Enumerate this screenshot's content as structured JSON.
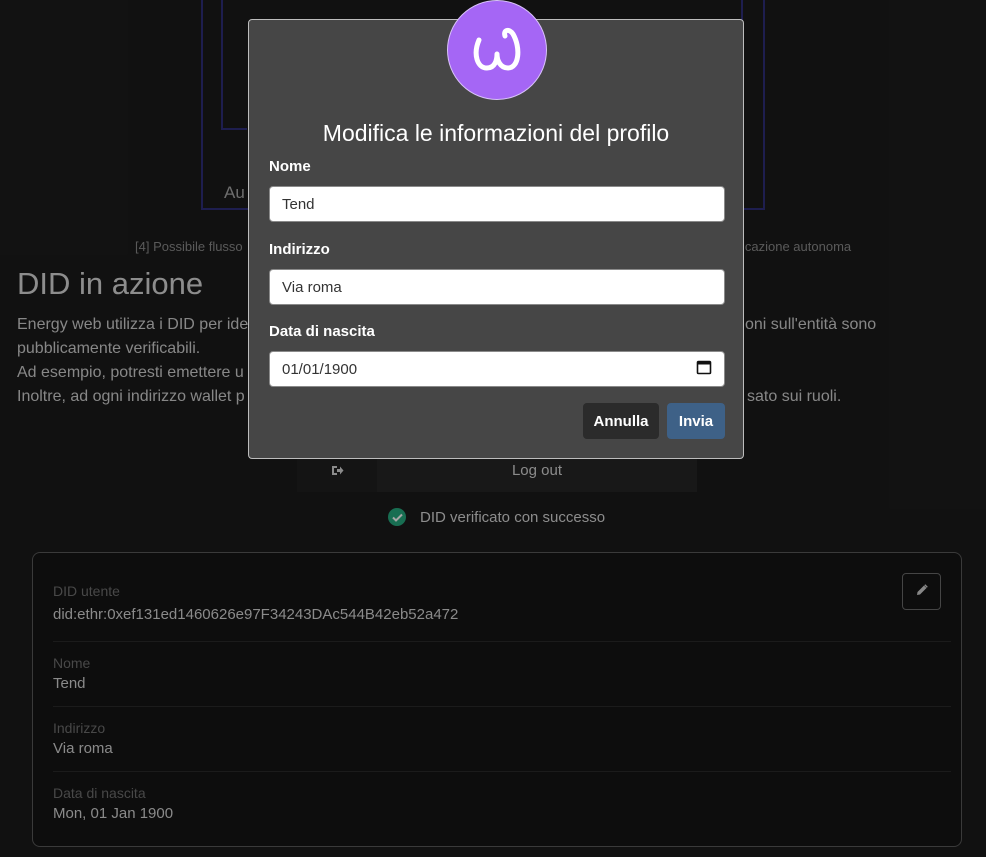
{
  "background": {
    "diagram_fragment": "Au",
    "caption_left": "[4] Possibile flusso",
    "caption_right": "icazione autonoma",
    "heading": "DID in azione",
    "paragraph_line1": "Energy web utilizza i DID per ide",
    "paragraph_line1_right": "oni sull'entità sono",
    "paragraph_line2": "pubblicamente verificabili.",
    "paragraph_line3": "Ad esempio, potresti emettere u",
    "paragraph_line4": "Inoltre, ad ogni indirizzo wallet p",
    "paragraph_line4_right": "sato sui ruoli.",
    "logout_label": "Log out",
    "verified_text": "DID verificato con successo"
  },
  "profile_card": {
    "did_label": "DID utente",
    "did_value": "did:ethr:0xef131ed1460626e97F34243DAc544B42eb52a472",
    "name_label": "Nome",
    "name_value": "Tend",
    "address_label": "Indirizzo",
    "address_value": "Via roma",
    "birth_label": "Data di nascita",
    "birth_value": "Mon, 01 Jan 1900"
  },
  "modal": {
    "title": "Modifica le informazioni del profilo",
    "name_label": "Nome",
    "name_value": "Tend",
    "address_label": "Indirizzo",
    "address_value": "Via roma",
    "birth_label": "Data di nascita",
    "birth_value": "01/01/1900",
    "cancel_label": "Annulla",
    "submit_label": "Invia"
  },
  "colors": {
    "logo": "#a566f5",
    "submit": "#3e6187",
    "verified": "#26a97e"
  }
}
